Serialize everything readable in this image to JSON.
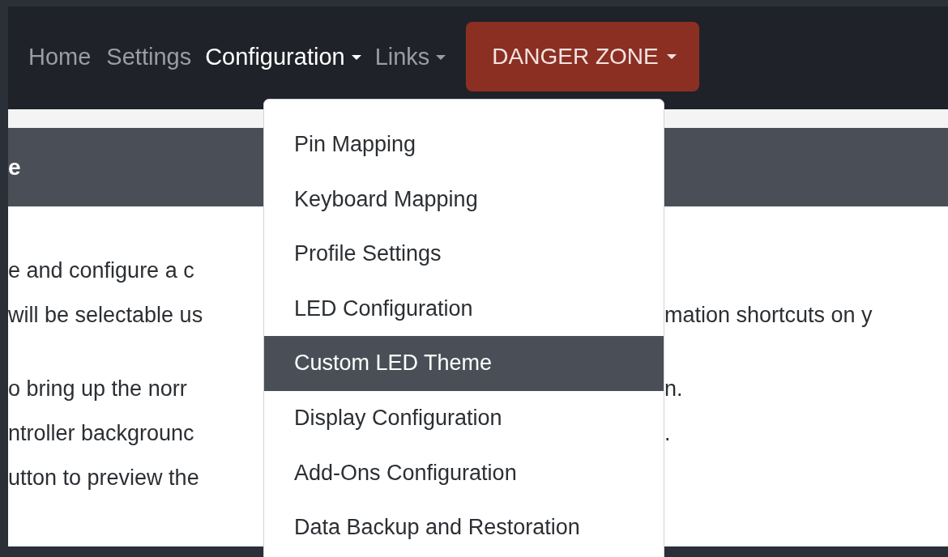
{
  "navbar": {
    "items": [
      {
        "label": "Home",
        "kind": "link",
        "selected": false,
        "dropdown": false
      },
      {
        "label": "Settings",
        "kind": "link",
        "selected": false,
        "dropdown": false
      },
      {
        "label": "Configuration",
        "kind": "link",
        "selected": true,
        "dropdown": true
      },
      {
        "label": "Links",
        "kind": "link",
        "selected": false,
        "dropdown": true
      },
      {
        "label": "DANGER ZONE",
        "kind": "danger",
        "dropdown": true
      }
    ]
  },
  "dropdown_menu": {
    "items": [
      {
        "label": "Pin Mapping",
        "selected": false
      },
      {
        "label": "Keyboard Mapping",
        "selected": false
      },
      {
        "label": "Profile Settings",
        "selected": false
      },
      {
        "label": "LED Configuration",
        "selected": false
      },
      {
        "label": "Custom LED Theme",
        "selected": true
      },
      {
        "label": "Display Configuration",
        "selected": false
      },
      {
        "label": "Add-Ons Configuration",
        "selected": false
      },
      {
        "label": "Data Backup and Restoration",
        "selected": false
      }
    ]
  },
  "card": {
    "header": "e",
    "paragraphs": [
      [
        {
          "left": "e and configure a c"
        },
        {
          "left": "will be selectable us",
          "right": "mation shortcuts on y"
        }
      ],
      [
        {
          "left": "o bring up the norr",
          "right": "n."
        },
        {
          "left": "ntroller backgrounc",
          "right": "."
        },
        {
          "left": "utton to preview the"
        }
      ]
    ]
  }
}
